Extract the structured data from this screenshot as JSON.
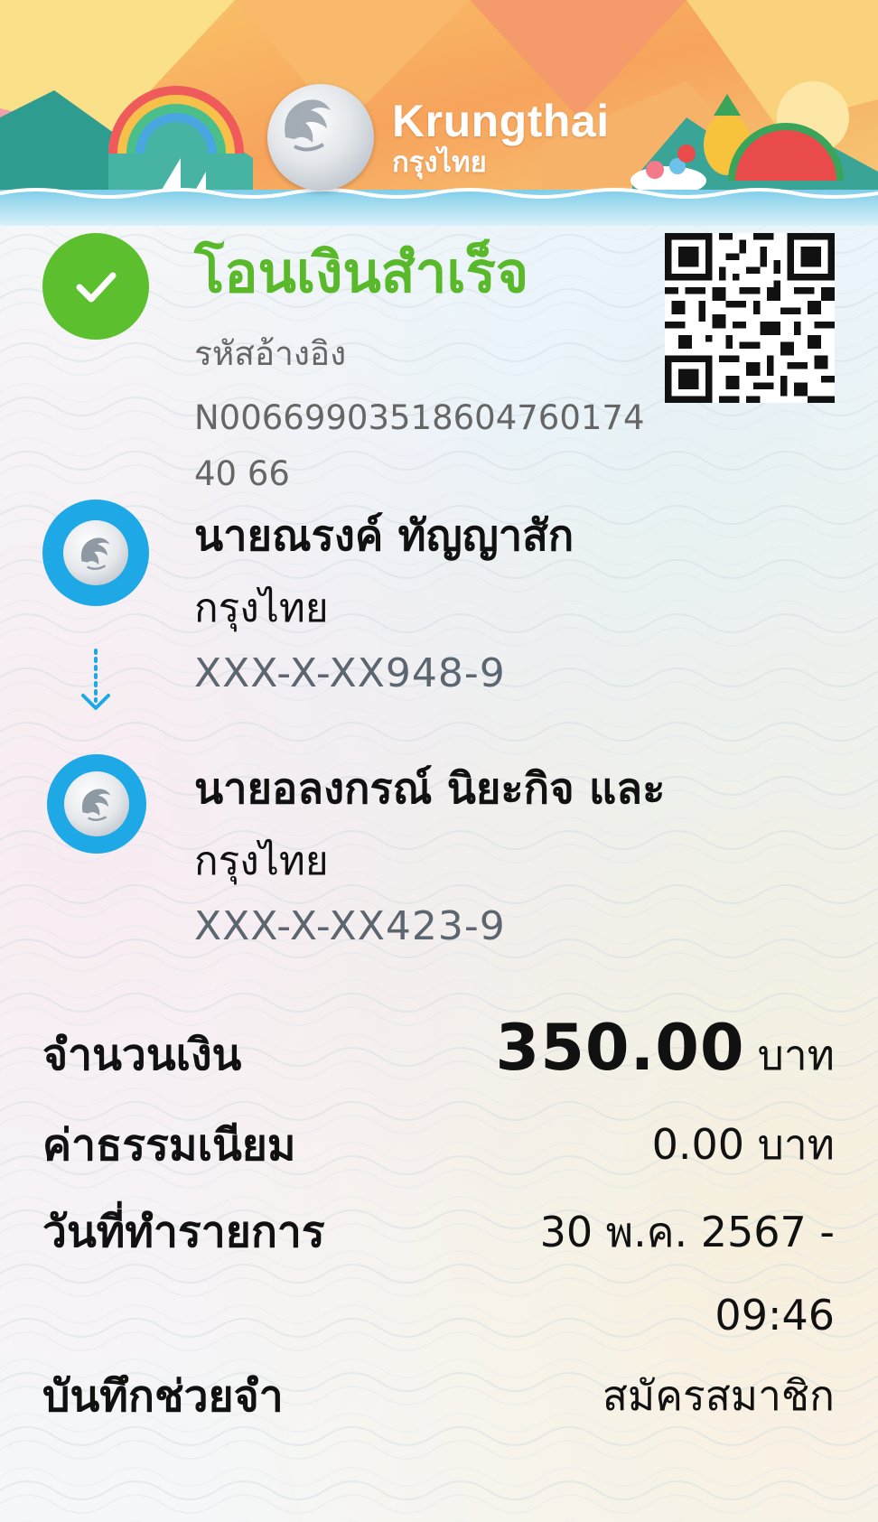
{
  "brand": {
    "name_en": "Krungthai",
    "name_th": "กรุงไทย"
  },
  "status": {
    "title": "โอนเงินสำเร็จ",
    "ref_label": "รหัสอ้างอิง",
    "ref_code": "N0066990351860476017440 66"
  },
  "sender": {
    "name": "นายณรงค์ ทัญญาสัก",
    "bank": "กรุงไทย",
    "account": "XXX-X-XX948-9"
  },
  "receiver": {
    "name": "นายอลงกรณ์ นิยะกิจ และ",
    "bank": "กรุงไทย",
    "account": "XXX-X-XX423-9"
  },
  "details": {
    "amount_label": "จำนวนเงิน",
    "amount_value": "350.00",
    "amount_unit": "บาท",
    "fee_label": "ค่าธรรมเนียม",
    "fee_value": "0.00 บาท",
    "date_label": "วันที่ทำรายการ",
    "date_value": "30 พ.ค. 2567 - 09:46",
    "memo_label": "บันทึกช่วยจำ",
    "memo_value": "สมัครสมาชิก"
  },
  "colors": {
    "success_green": "#5cbf2e",
    "brand_blue": "#1ea9e6",
    "banner_orange": "#f4874f"
  },
  "icons": {
    "success": "check-circle-icon",
    "bank": "krungthai-bird-logo-icon",
    "arrow": "dotted-arrow-down-icon",
    "qr": "qr-code-icon"
  }
}
